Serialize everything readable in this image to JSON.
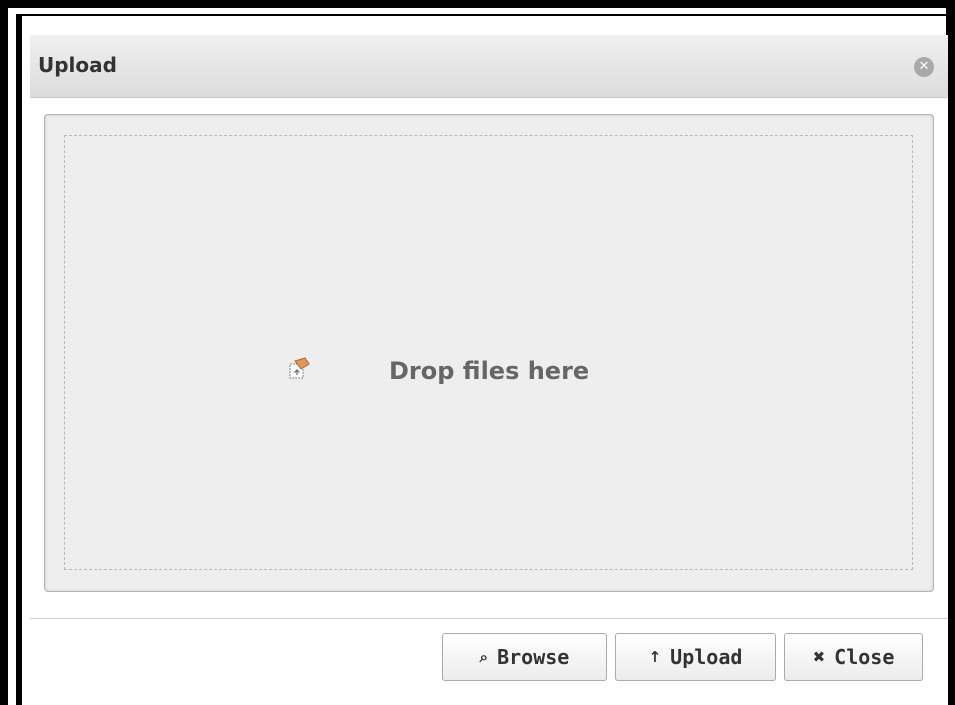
{
  "dialog": {
    "title": "Upload",
    "close_icon": "close-circle-icon"
  },
  "dropzone": {
    "icon": "drag-drop-icon",
    "text": "Drop files here"
  },
  "footer": {
    "browse": {
      "icon": "search-icon",
      "glyph": "⌕",
      "label": "Browse"
    },
    "upload": {
      "icon": "arrow-up-icon",
      "glyph": "↑",
      "label": "Upload"
    },
    "close": {
      "icon": "close-icon",
      "glyph": "✖",
      "label": "Close"
    }
  },
  "colors": {
    "titlebar": "#dcdcdc",
    "panel": "#eeeeee",
    "text": "#666666"
  }
}
